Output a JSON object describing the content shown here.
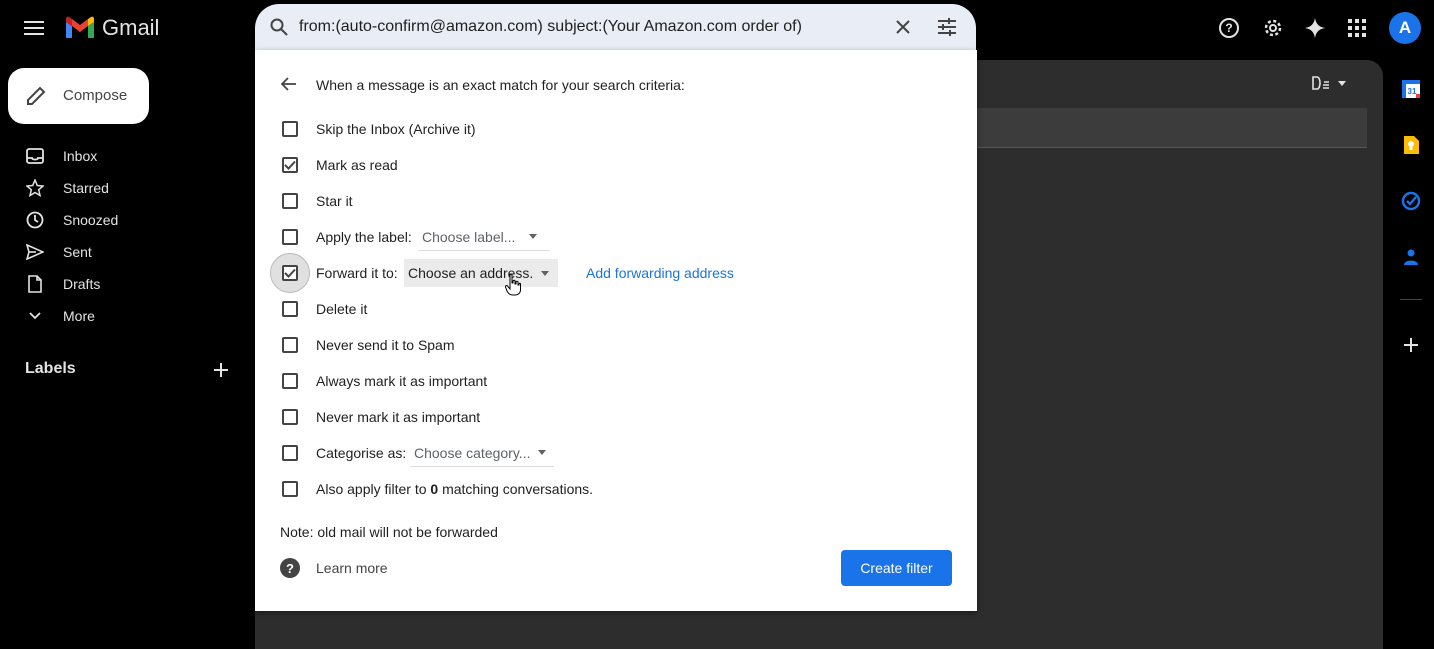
{
  "header": {
    "app_name": "Gmail",
    "search_query": "from:(auto-confirm@amazon.com) subject:(Your Amazon.com order of)",
    "avatar_letter": "A"
  },
  "sidebar": {
    "compose_label": "Compose",
    "items": [
      {
        "label": "Inbox",
        "icon": "inbox-icon"
      },
      {
        "label": "Starred",
        "icon": "star-icon"
      },
      {
        "label": "Snoozed",
        "icon": "clock-icon"
      },
      {
        "label": "Sent",
        "icon": "send-icon"
      },
      {
        "label": "Drafts",
        "icon": "draft-icon"
      },
      {
        "label": "More",
        "icon": "chevron-down-icon"
      }
    ],
    "labels_title": "Labels"
  },
  "filter": {
    "title": "When a message is an exact match for your search criteria:",
    "options": [
      {
        "label": "Skip the Inbox (Archive it)",
        "checked": false
      },
      {
        "label": "Mark as read",
        "checked": true
      },
      {
        "label": "Star it",
        "checked": false
      },
      {
        "label": "Apply the label:",
        "checked": false,
        "dropdown": "Choose label..."
      },
      {
        "label": "Forward it to:",
        "checked": true,
        "dropdown": "Choose an address.",
        "link": "Add forwarding address"
      },
      {
        "label": "Delete it",
        "checked": false
      },
      {
        "label": "Never send it to Spam",
        "checked": false
      },
      {
        "label": "Always mark it as important",
        "checked": false
      },
      {
        "label": "Never mark it as important",
        "checked": false
      },
      {
        "label": "Categorise as:",
        "checked": false,
        "dropdown": "Choose category..."
      },
      {
        "label_pre": "Also apply filter to ",
        "label_count": "0",
        "label_post": " matching conversations.",
        "checked": false
      }
    ],
    "note": "Note: old mail will not be forwarded",
    "learn_more": "Learn more",
    "create_button": "Create filter"
  },
  "colors": {
    "accent": "#1a73e8",
    "background": "#000000",
    "panel": "#ffffff"
  }
}
